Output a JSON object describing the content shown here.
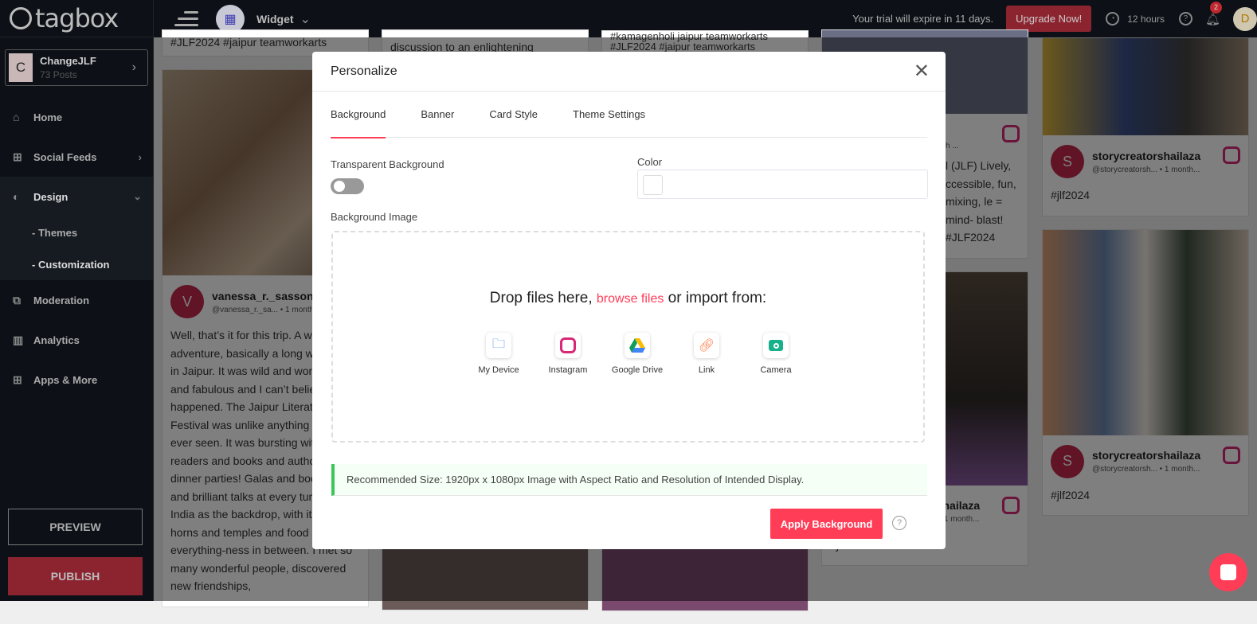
{
  "brand": "tagbox",
  "account": {
    "initial": "C",
    "name": "ChangeJLF",
    "posts": "73 Posts"
  },
  "nav": [
    {
      "label": "Home",
      "icon": "home-icon"
    },
    {
      "label": "Social Feeds",
      "icon": "add-feed-icon"
    },
    {
      "label": "Design",
      "icon": "design-icon"
    },
    {
      "label": "Moderation",
      "icon": "moderation-icon"
    },
    {
      "label": "Analytics",
      "icon": "analytics-icon"
    },
    {
      "label": "Apps & More",
      "icon": "apps-icon"
    }
  ],
  "design_sub": [
    "- Themes",
    "- Customization"
  ],
  "preview": "PREVIEW",
  "publish": "PUBLISH",
  "topbar": {
    "widget": "Widget",
    "trial": "Your trial will expire in 11 days.",
    "upgrade": "Upgrade Now!",
    "hours": "12 hours",
    "notifications": "2",
    "user_initial": "D"
  },
  "feed": {
    "c1_top": "#JLF2024 #jaipur teamworkarts",
    "c2_top": "discussion to an enlightening",
    "c3_top": "#kamagenholi jaipur teamworkarts",
    "c3_top2": "#JLF2024 #jaipur teamworkarts",
    "post1": {
      "initial": "V",
      "name": "vanessa_r._sasson",
      "handle": "@vanessa_r._sa...  •  1 month...",
      "text": "Well, that’s it for this trip. A whirlwind adventure, basically a long weekend in Jaipur. It was wild and wonderful and fabulous and I can’t believe it happened. The Jaipur Literature Festival was unlike anything I have ever seen. It was bursting with readers and books and authors and dinner parties! Galas and bookstores and brilliant talks at every turn. And India as the backdrop, with its honking horns and temples and food and its everything-ness in between. I met so many wonderful people, discovered new friendships,"
    },
    "c4_snip": {
      "meta": "h ...",
      "text": "l (JLF) Lively, ccessible, fun, mixing, le = mind- blast! #JLF2024"
    },
    "c4_post": {
      "name": "storycreatorshailaza",
      "handle": "@storycreatorsh...  •  1 month...",
      "text": "#jlf2024"
    },
    "c5_posts": [
      {
        "initial": "S",
        "name": "storycreatorshailaza",
        "handle": "@storycreatorsh...  •  1 month...",
        "text": "#jlf2024"
      },
      {
        "initial": "S",
        "name": "storycreatorshailaza",
        "handle": "@storycreatorsh...  •  1 month...",
        "text": "#jlf2024"
      }
    ]
  },
  "modal": {
    "title": "Personalize",
    "tabs": [
      "Background",
      "Banner",
      "Card Style",
      "Theme Settings"
    ],
    "active_tab": "Background",
    "transparent_label": "Transparent Background",
    "transparent_on": false,
    "color_label": "Color",
    "color_value": "#ffffff",
    "bg_image_label": "Background Image",
    "drop_pre": "Drop files here,",
    "drop_link": "browse files",
    "drop_post": "or import from:",
    "sources": [
      {
        "label": "My Device",
        "icon": "folder-icon"
      },
      {
        "label": "Instagram",
        "icon": "instagram-icon"
      },
      {
        "label": "Google Drive",
        "icon": "google-drive-icon"
      },
      {
        "label": "Link",
        "icon": "link-icon"
      },
      {
        "label": "Camera",
        "icon": "camera-icon"
      }
    ],
    "recommendation": "Recommended Size: 1920px x 1080px Image with Aspect Ratio and Resolution of Intended Display.",
    "apply": "Apply Background"
  },
  "colors": {
    "accent": "#ff3d57",
    "sidebar": "#0d1117",
    "success": "#3bc55a"
  }
}
